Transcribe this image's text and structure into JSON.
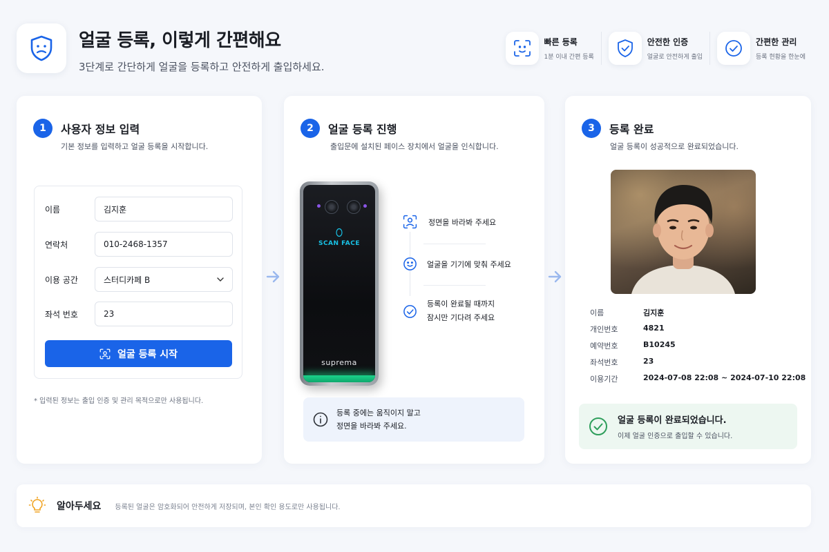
{
  "header": {
    "title": "얼굴 등록, 이렇게 간편해요",
    "subtitle": "3단계로 간단하게 얼굴을 등록하고 안전하게 출입하세요.",
    "logo_icon": "shield-face-icon"
  },
  "features": [
    {
      "icon": "face-scan-icon",
      "title": "빠른 등록",
      "desc": "1분 이내 간편 등록"
    },
    {
      "icon": "shield-check-icon",
      "title": "안전한 인증",
      "desc": "얼굴로 안전하게 출입"
    },
    {
      "icon": "check-circle-icon",
      "title": "간편한 관리",
      "desc": "등록 현황을 한눈에"
    }
  ],
  "step1": {
    "number": "1",
    "title": "사용자 정보 입력",
    "desc": "기본 정보를 입력하고 얼굴 등록을 시작합니다.",
    "fields": {
      "name": {
        "label": "이름",
        "value": "김지훈"
      },
      "phone": {
        "label": "연락처",
        "value": "010-2468-1357"
      },
      "space": {
        "label": "이용 공간",
        "value": "스터디카페 B"
      },
      "seat": {
        "label": "좌석 번호",
        "value": "23"
      }
    },
    "button": "얼굴 등록 시작",
    "note": "* 입력된 정보는 출입 인증 및 관리 목적으로만 사용됩니다."
  },
  "step2": {
    "number": "2",
    "title": "얼굴 등록 진행",
    "desc": "출입문에 설치된 페이스 장치에서 얼굴을 인식합니다.",
    "device_screen_text": "SCAN FACE",
    "device_brand": "suprema",
    "guides": [
      {
        "icon": "face-frame-icon",
        "line1": "정면을 바라봐 주세요",
        "line2": ""
      },
      {
        "icon": "smile-icon",
        "line1": "얼굴을 기기에 맞춰 주세요",
        "line2": ""
      },
      {
        "icon": "check-circle-icon",
        "line1": "등록이 완료될 때까지",
        "line2": "잠시만 기다려 주세요"
      }
    ],
    "info_line1": "등록 중에는 움직이지 말고",
    "info_line2": "정면을 바라봐 주세요."
  },
  "step3": {
    "number": "3",
    "title": "등록 완료",
    "desc": "얼굴 등록이 성공적으로 완료되었습니다.",
    "details": [
      {
        "label": "이름",
        "value": "김지훈"
      },
      {
        "label": "개인번호",
        "value": "4821"
      },
      {
        "label": "예약번호",
        "value": "B10245"
      },
      {
        "label": "좌석번호",
        "value": "23"
      },
      {
        "label": "이용기간",
        "value": "2024-07-08 22:08 ~ 2024-07-10 22:08"
      }
    ],
    "done_title": "얼굴 등록이 완료되었습니다.",
    "done_desc": "이제 얼굴 인증으로 출입할 수 있습니다."
  },
  "footer": {
    "title": "알아두세요",
    "text": "등록된 얼굴은 암호화되어 안전하게 저장되며, 본인 확인 용도로만 사용됩니다."
  },
  "colors": {
    "primary": "#1a64e8",
    "success": "#2e9e5b",
    "background": "#f5f7fb"
  }
}
